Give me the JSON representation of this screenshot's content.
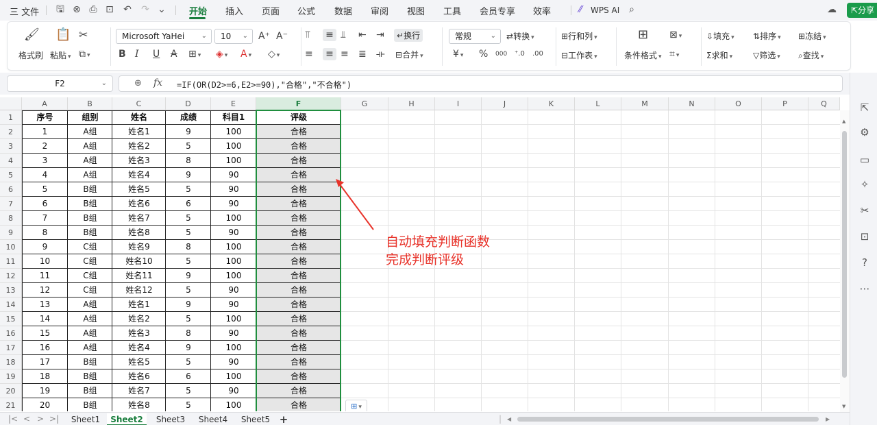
{
  "menubar": {
    "file_label": "三 文件",
    "tabs": [
      "开始",
      "插入",
      "页面",
      "公式",
      "数据",
      "审阅",
      "视图",
      "工具",
      "会员专享",
      "效率"
    ],
    "active_tab": "开始",
    "wps_ai_label": "WPS AI",
    "share_label": "分享",
    "accent_color": "#1a7e3e"
  },
  "ribbon": {
    "format_painter": "格式刷",
    "paste": "粘贴",
    "font_name": "Microsoft YaHei",
    "font_size": "10",
    "wrap_text": "换行",
    "merge": "合并",
    "number_format": "常规",
    "convert": "转换",
    "rows_cols": "行和列",
    "worksheet": "工作表",
    "cond_format": "条件格式",
    "fill": "填充",
    "sort": "排序",
    "freeze": "冻结",
    "sum": "求和",
    "filter": "筛选",
    "find": "查找",
    "bold": "B",
    "italic": "I",
    "underline": "U",
    "strike": "A",
    "currency": "¥",
    "percent": "%",
    "thousands": "000"
  },
  "formula_bar": {
    "cell_ref": "F2",
    "formula": "=IF(OR(D2>=6,E2>=90),\"合格\",\"不合格\")"
  },
  "columns": [
    "A",
    "B",
    "C",
    "D",
    "E",
    "F",
    "G",
    "H",
    "I",
    "J",
    "K",
    "L",
    "M",
    "N",
    "O",
    "P",
    "Q"
  ],
  "selected_column": "F",
  "row_numbers": [
    "1",
    "2",
    "3",
    "4",
    "5",
    "6",
    "7",
    "8",
    "9",
    "10",
    "11",
    "12",
    "13",
    "14",
    "15",
    "16",
    "17",
    "18",
    "19",
    "20",
    "21"
  ],
  "table": {
    "headers": [
      "序号",
      "组别",
      "姓名",
      "成绩",
      "科目1",
      "评级"
    ],
    "rows": [
      [
        "1",
        "A组",
        "姓名1",
        "9",
        "100",
        "合格"
      ],
      [
        "2",
        "A组",
        "姓名2",
        "5",
        "100",
        "合格"
      ],
      [
        "3",
        "A组",
        "姓名3",
        "8",
        "100",
        "合格"
      ],
      [
        "4",
        "A组",
        "姓名4",
        "9",
        "90",
        "合格"
      ],
      [
        "5",
        "B组",
        "姓名5",
        "5",
        "90",
        "合格"
      ],
      [
        "6",
        "B组",
        "姓名6",
        "6",
        "90",
        "合格"
      ],
      [
        "7",
        "B组",
        "姓名7",
        "5",
        "100",
        "合格"
      ],
      [
        "8",
        "B组",
        "姓名8",
        "5",
        "90",
        "合格"
      ],
      [
        "9",
        "C组",
        "姓名9",
        "8",
        "100",
        "合格"
      ],
      [
        "10",
        "C组",
        "姓名10",
        "5",
        "100",
        "合格"
      ],
      [
        "11",
        "C组",
        "姓名11",
        "9",
        "100",
        "合格"
      ],
      [
        "12",
        "C组",
        "姓名12",
        "5",
        "90",
        "合格"
      ],
      [
        "13",
        "A组",
        "姓名1",
        "9",
        "90",
        "合格"
      ],
      [
        "14",
        "A组",
        "姓名2",
        "5",
        "100",
        "合格"
      ],
      [
        "15",
        "A组",
        "姓名3",
        "8",
        "90",
        "合格"
      ],
      [
        "16",
        "A组",
        "姓名4",
        "9",
        "100",
        "合格"
      ],
      [
        "17",
        "B组",
        "姓名5",
        "5",
        "90",
        "合格"
      ],
      [
        "18",
        "B组",
        "姓名6",
        "6",
        "100",
        "合格"
      ],
      [
        "19",
        "B组",
        "姓名7",
        "5",
        "90",
        "合格"
      ],
      [
        "20",
        "B组",
        "姓名8",
        "5",
        "100",
        "合格"
      ]
    ]
  },
  "annotation": {
    "line1": "自动填充判断函数",
    "line2": "完成判断评级",
    "color": "#e8332a"
  },
  "sheets": [
    "Sheet1",
    "Sheet2",
    "Sheet3",
    "Sheet4",
    "Sheet5"
  ],
  "active_sheet": "Sheet2",
  "add_sheet": "+"
}
